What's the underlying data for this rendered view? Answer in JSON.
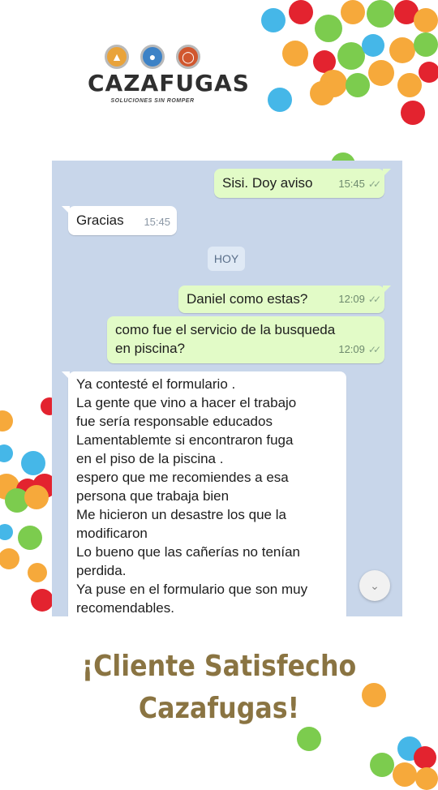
{
  "brand": {
    "name": "CAZAFUGAS",
    "tagline": "SOLUCIONES SIN ROMPER",
    "icons": [
      "fire-icon",
      "water-drop-icon",
      "gas-meter-icon"
    ],
    "colors": {
      "fire": "#e9a33a",
      "water": "#3d82c6",
      "gas": "#d1572e"
    }
  },
  "chat": {
    "background": "#c8d6ea",
    "day_separator": "HOY",
    "messages": [
      {
        "direction": "out",
        "text": "Sisi. Doy aviso",
        "time": "15:45",
        "status": "read"
      },
      {
        "direction": "in",
        "text": "Gracias",
        "time": "15:45"
      },
      {
        "direction": "out",
        "text": "Daniel como estas?",
        "time": "12:09",
        "status": "read"
      },
      {
        "direction": "out",
        "text": "como fue el servicio de la busqueda\nen piscina?",
        "time": "12:09",
        "status": "read"
      },
      {
        "direction": "in",
        "text": "Ya contesté el  formulario .\nLa gente que vino a hacer el trabajo\nfue  sería responsable educados\nLamentablemte si encontraron fuga\nen el piso de la piscina .\nespero que me recomiendes a esa\npersona que trabaja bien\nMe hicieron un desastre los que la\nmodificaron\nLo bueno que las cañerías no tenían\nperdida.\nYa puse en el formulario que son muy\nrecomendables."
      }
    ],
    "tick_glyph": "✓✓",
    "scroll_icon": "chevron-down-icon"
  },
  "caption": {
    "line1": "¡Cliente Satisfecho",
    "line2": "Cazafugas!",
    "color": "#8a7442"
  },
  "confetti_colors": [
    "#45b7e8",
    "#e3232f",
    "#7ccc4e",
    "#f6a93b"
  ]
}
